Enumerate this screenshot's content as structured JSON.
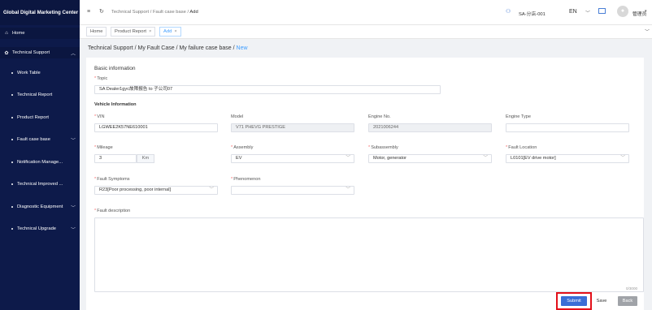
{
  "sidebar": {
    "brand": "Global Digital Marketing Center",
    "items": [
      {
        "label": "Home",
        "icon": "home-icon",
        "glyph": "⌂"
      },
      {
        "label": "Technical Support",
        "icon": "gear-icon",
        "glyph": "✿"
      },
      {
        "label": "Work Table"
      },
      {
        "label": "Technical Report"
      },
      {
        "label": "Product Report"
      },
      {
        "label": "Fault case base"
      },
      {
        "label": "Notification Manage..."
      },
      {
        "label": "Technical Improved ..."
      },
      {
        "label": "Diagnostic Equipment"
      },
      {
        "label": "Technical Upgrade"
      }
    ]
  },
  "header": {
    "breadcrumb": [
      "Technical Support",
      "Fault case base",
      "Add"
    ],
    "user_id": "SA-分店-001",
    "lang": "EN",
    "username": "管理员"
  },
  "tabs": [
    {
      "label": "Home"
    },
    {
      "label": "Product Report"
    },
    {
      "label": "Add"
    }
  ],
  "breadcrumb": [
    "Technical Support",
    "My Fault Case",
    "My failure case base",
    "New"
  ],
  "form": {
    "basic_info": "Basic information",
    "topic_label": "Topic",
    "topic_value": "SA Dealer1gyc故障报告 to 子公司07",
    "vehicle_info": "Vehicle Information",
    "vin_label": "VIN",
    "vin_value": "LGWEE2K57NE610001",
    "model_label": "Model",
    "model_value": "V71 PHEVG PRESTIGE",
    "engine_no_label": "Engine No.",
    "engine_no_value": "2021006244",
    "engine_type_label": "Engine Type",
    "engine_type_value": "",
    "mileage_label": "Mileage",
    "mileage_value": "3",
    "mileage_unit": "Km",
    "assembly_label": "Assembly",
    "assembly_value": "EV",
    "subassembly_label": "Subassembly",
    "subassembly_value": "Motor, generator",
    "fault_location_label": "Fault Location",
    "fault_location_value": "L0101[EV drive motor]",
    "fault_symptoms_label": "Fault Symptoms",
    "fault_symptoms_value": "R23[Poor processing, poor internal]",
    "phenomenon_label": "Phenomenon",
    "phenomenon_value": "",
    "fault_desc_label": "Fault description",
    "fault_desc_counter": "0/3000"
  },
  "buttons": {
    "submit": "Submit",
    "save": "Save",
    "back": "Back"
  },
  "colors": {
    "sidebar_bg": "#0d1a4a",
    "accent": "#409eff",
    "submit_bg": "#3a6ed6",
    "highlight": "#e3101a"
  }
}
